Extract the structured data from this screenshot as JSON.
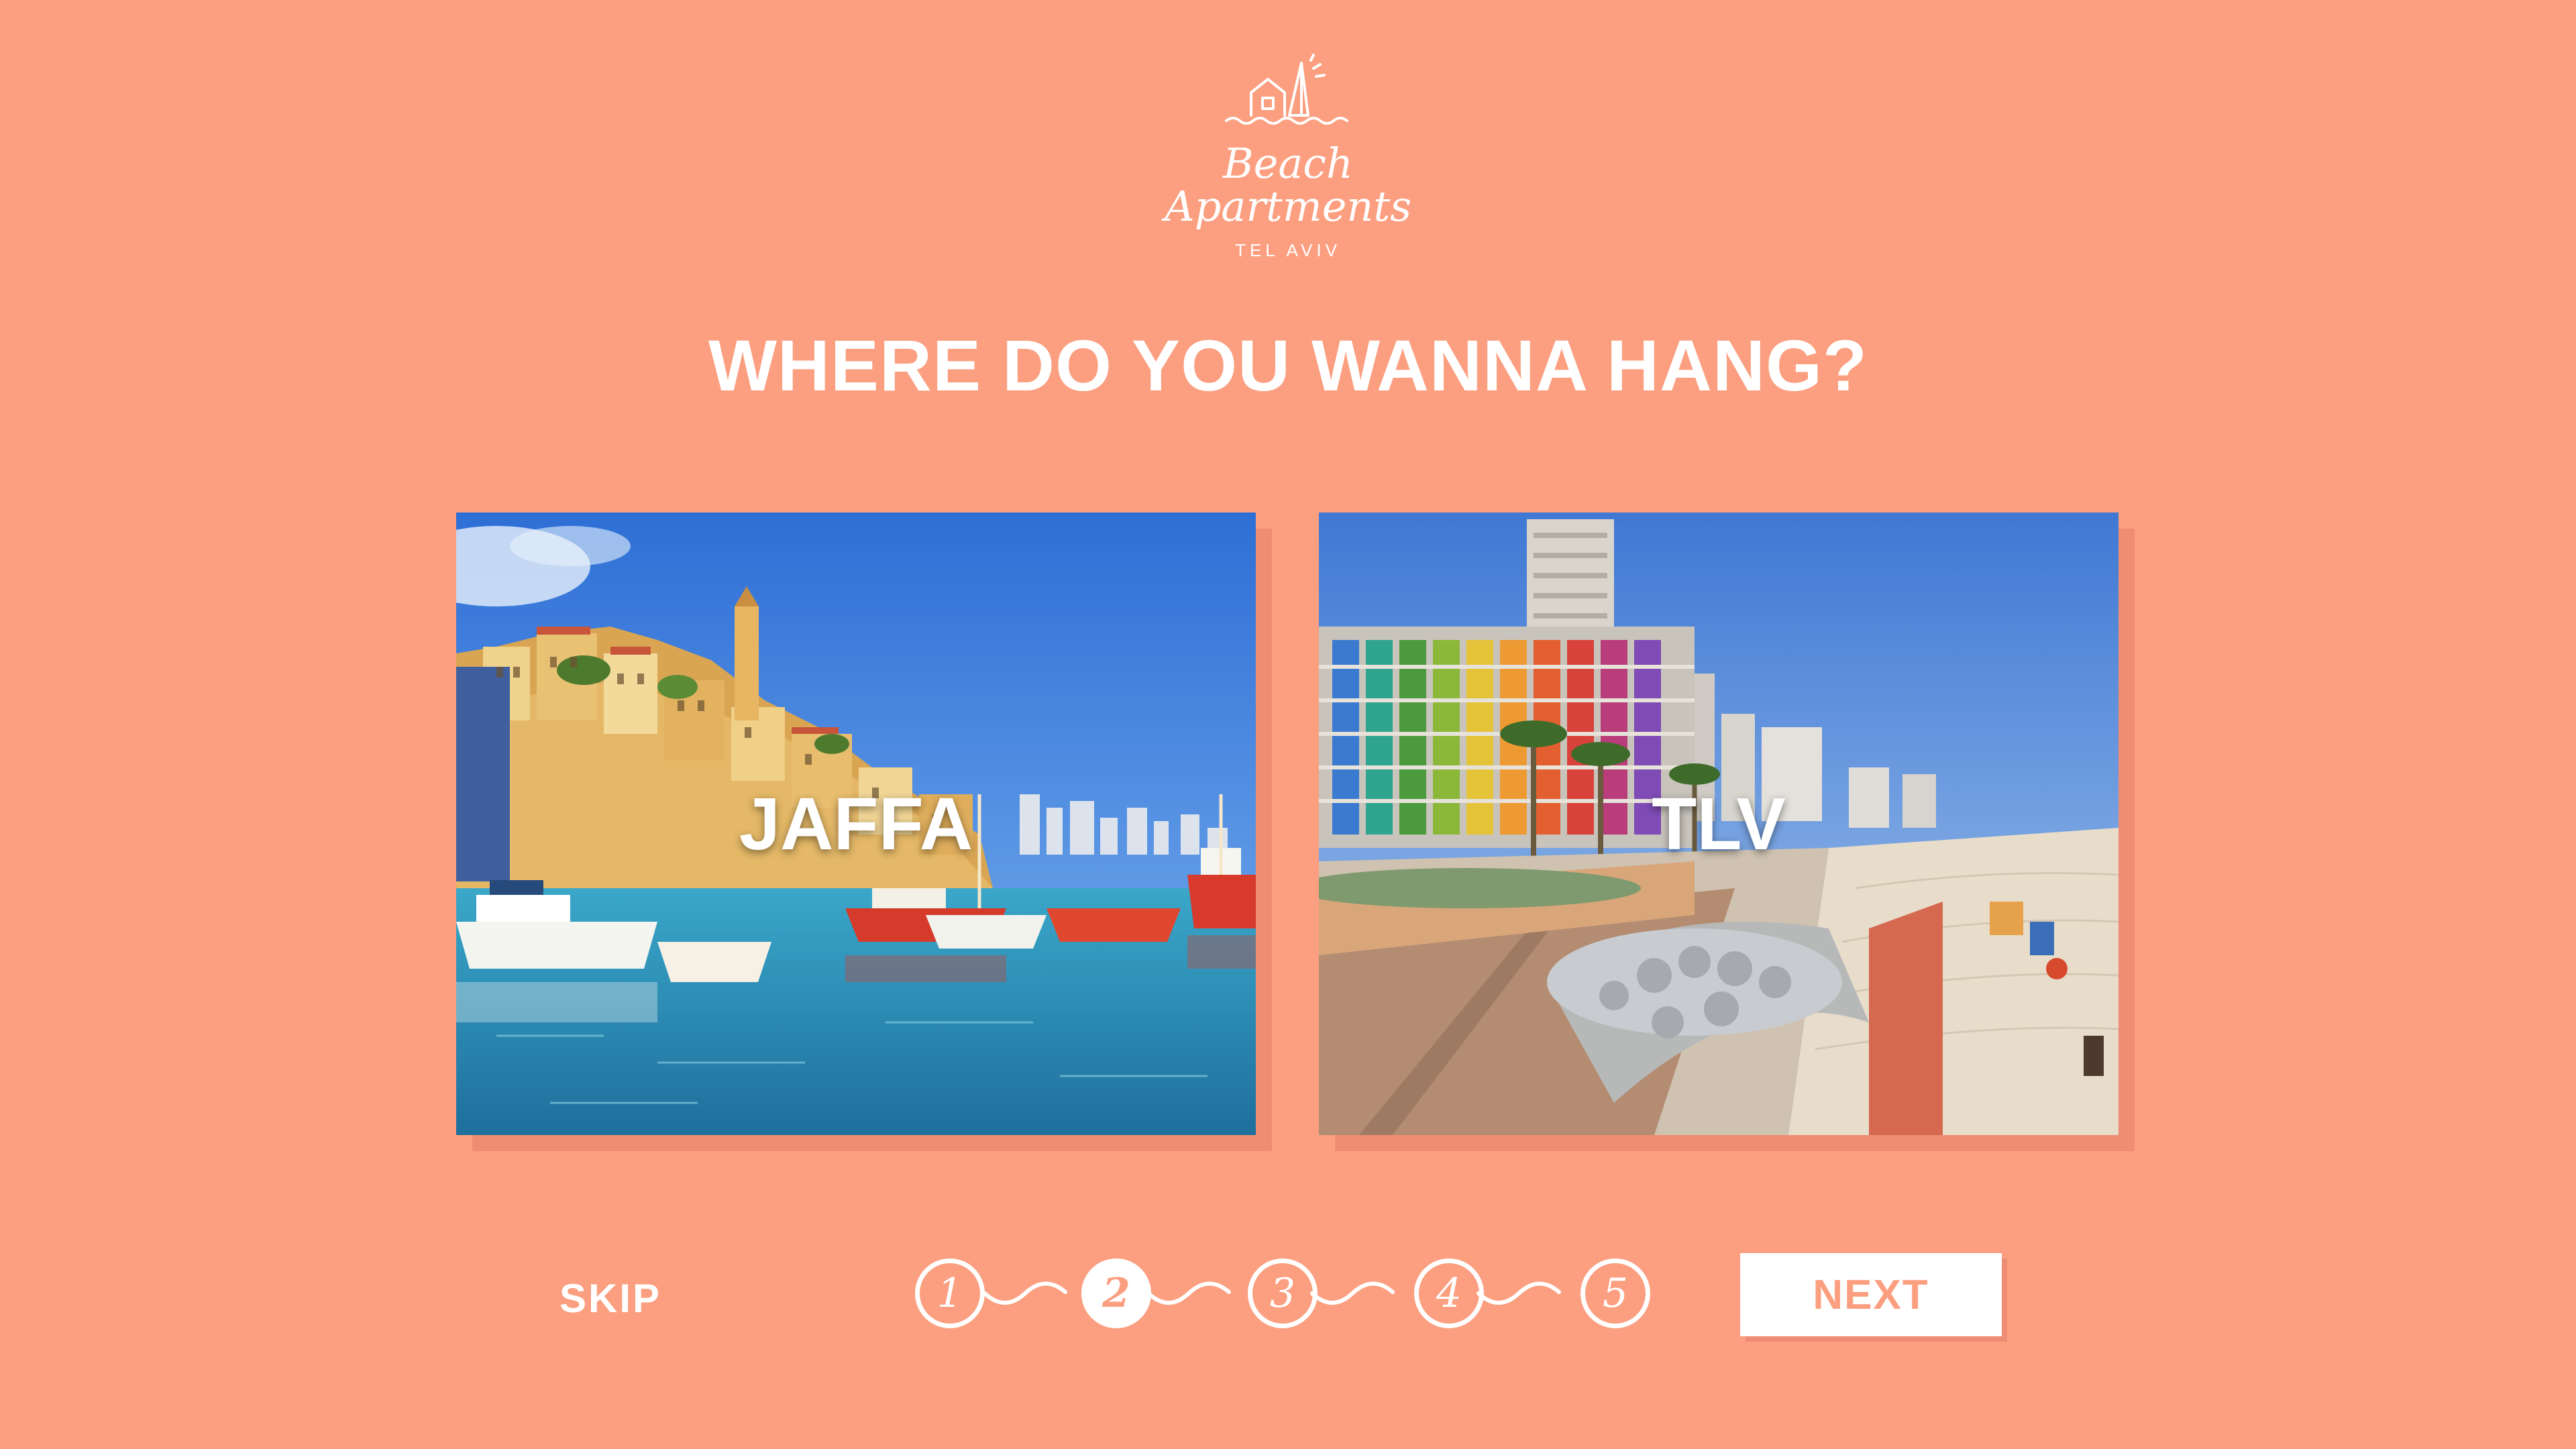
{
  "logo": {
    "line1": "Beach",
    "line2": "Apartments",
    "subtitle": "TEL AVIV"
  },
  "headline": "WHERE DO YOU WANNA HANG?",
  "options": [
    {
      "label": "JAFFA"
    },
    {
      "label": "TLV"
    }
  ],
  "footer": {
    "skip_label": "SKIP",
    "next_label": "NEXT",
    "steps": [
      "1",
      "2",
      "3",
      "4",
      "5"
    ],
    "current_step": 2
  },
  "colors": {
    "background": "#FB9F80",
    "white": "#FFFFFF",
    "shadow": "#EE8D73"
  }
}
